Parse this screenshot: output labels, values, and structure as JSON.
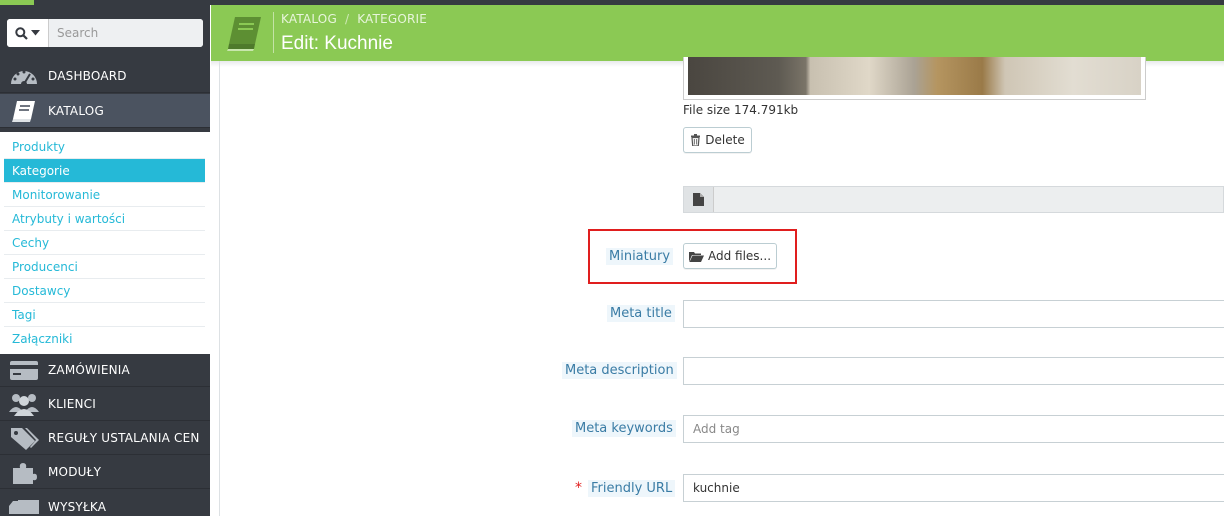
{
  "search": {
    "placeholder": "Search"
  },
  "sidebar": {
    "items": [
      {
        "label": "DASHBOARD",
        "icon": "dashboard-icon"
      },
      {
        "label": "KATALOG",
        "icon": "book-icon"
      },
      {
        "label": "ZAMÓWIENIA",
        "icon": "credit-card-icon"
      },
      {
        "label": "KLIENCI",
        "icon": "users-icon"
      },
      {
        "label": "REGUŁY USTALANIA CEN",
        "icon": "tags-icon"
      },
      {
        "label": "MODUŁY",
        "icon": "puzzle-icon"
      },
      {
        "label": "WYSYŁKA",
        "icon": "truck-icon"
      }
    ],
    "submenu": [
      "Produkty",
      "Kategorie",
      "Monitorowanie",
      "Atrybuty i wartości",
      "Cechy",
      "Producenci",
      "Dostawcy",
      "Tagi",
      "Załączniki"
    ],
    "active_submenu": "Kategorie"
  },
  "header": {
    "breadcrumb": [
      "KATALOG",
      "KATEGORIE"
    ],
    "title": "Edit: Kuchnie",
    "icon": "book-icon"
  },
  "form": {
    "file_size": "File size 174.791kb",
    "delete_label": "Delete",
    "miniatury_label": "Miniatury",
    "add_files_label": "Add files...",
    "meta_title_label": "Meta title",
    "meta_title_value": "",
    "meta_description_label": "Meta description",
    "meta_description_value": "",
    "meta_keywords_label": "Meta keywords",
    "meta_keywords_placeholder": "Add tag",
    "required_mark": "*",
    "friendly_url_label": "Friendly URL",
    "friendly_url_value": "kuchnie"
  },
  "colors": {
    "header_bg": "#8bc954",
    "sidebar_bg": "#363a41",
    "accent": "#25b9d7",
    "highlight": "#e01e1e"
  }
}
